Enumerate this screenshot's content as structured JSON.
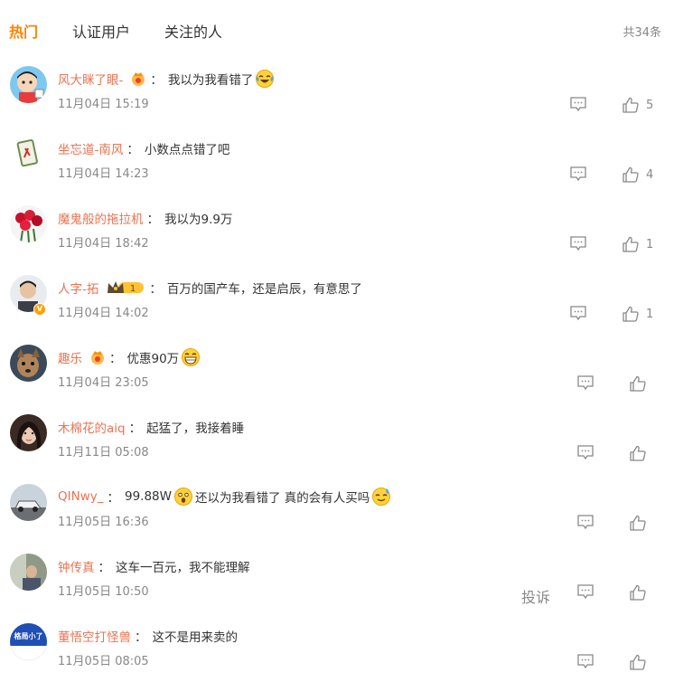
{
  "tabs": [
    {
      "label": "热门",
      "active": true
    },
    {
      "label": "认证用户",
      "active": false
    },
    {
      "label": "关注的人",
      "active": false
    }
  ],
  "total_count": "共34条",
  "report_label": "投诉",
  "colors": {
    "accent": "#ff8200",
    "username": "#eb7350",
    "muted": "#888888"
  },
  "comments": [
    {
      "username": "风大眯了眼-",
      "text": "我以为我看错了",
      "time": "11月04日 15:19",
      "likes": "5",
      "badge": "fan",
      "emoji": "tears-of-joy"
    },
    {
      "username": "坐忘道-南风",
      "text": "小数点点错了吧",
      "time": "11月04日 14:23",
      "likes": "4"
    },
    {
      "username": "魔鬼般的拖拉机",
      "text": "我以为9.9万",
      "time": "11月04日 18:42",
      "likes": "1"
    },
    {
      "username": "人字-拓",
      "text": "百万的国产车，还是启辰，有意思了",
      "time": "11月04日 14:02",
      "likes": "1",
      "badge": "vip",
      "vip_level": "1",
      "verified": true
    },
    {
      "username": "趣乐",
      "text": "优惠90万",
      "time": "11月04日 23:05",
      "likes": "",
      "badge": "fan",
      "emoji": "grin"
    },
    {
      "username": "木棉花的aiq",
      "text": "起猛了，我接着睡",
      "time": "11月11日 05:08",
      "likes": ""
    },
    {
      "username": "QINwy_",
      "text": "99.88W",
      "text2": "还以为我看错了 真的会有人买吗",
      "time": "11月05日 16:36",
      "likes": "",
      "emoji": "shocked",
      "emoji2": "sweat"
    },
    {
      "username": "钟传真",
      "text": "这车一百元，我不能理解",
      "time": "11月05日 10:50",
      "likes": "",
      "show_report": true
    },
    {
      "username": "董悟空打怪兽",
      "text": "这不是用来卖的",
      "time": "11月05日 08:05",
      "likes": "",
      "avatar_text": "格局小了"
    }
  ]
}
